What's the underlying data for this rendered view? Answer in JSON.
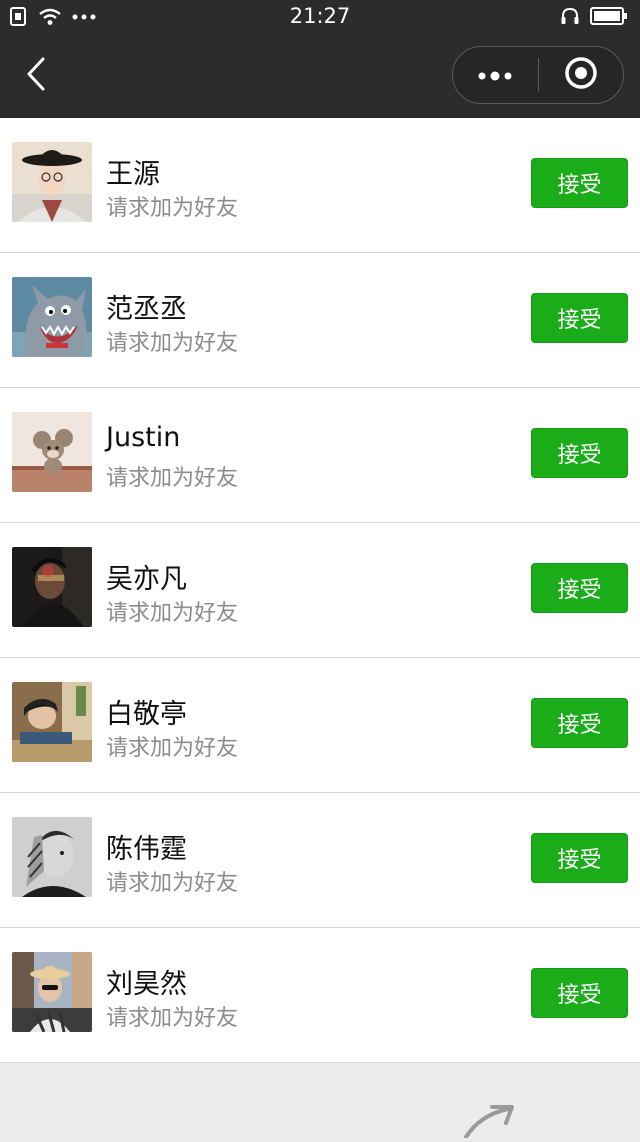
{
  "status_bar": {
    "time": "21:27",
    "left_icons": [
      "sim-icon",
      "wifi-icon",
      "more-dots-icon"
    ],
    "right_icons": [
      "headphones-icon",
      "battery-icon"
    ]
  },
  "nav_bar": {
    "back_icon": "chevron-left-icon",
    "capsule": {
      "menu_icon": "more-dots-icon",
      "close_icon": "record-circle-icon"
    }
  },
  "colors": {
    "accent_green": "#1aad19",
    "nav_background": "#2c2c2c",
    "secondary_text": "#8c8c8c"
  },
  "requests": [
    {
      "name": "王源",
      "subtitle": "请求加为好友",
      "action": "接受"
    },
    {
      "name": "范丞丞",
      "subtitle": "请求加为好友",
      "action": "接受"
    },
    {
      "name": "Justin",
      "subtitle": "请求加为好友",
      "action": "接受"
    },
    {
      "name": "吴亦凡",
      "subtitle": "请求加为好友",
      "action": "接受"
    },
    {
      "name": "白敬亭",
      "subtitle": "请求加为好友",
      "action": "接受"
    },
    {
      "name": "陈伟霆",
      "subtitle": "请求加为好友",
      "action": "接受"
    },
    {
      "name": "刘昊然",
      "subtitle": "请求加为好友",
      "action": "接受"
    }
  ]
}
